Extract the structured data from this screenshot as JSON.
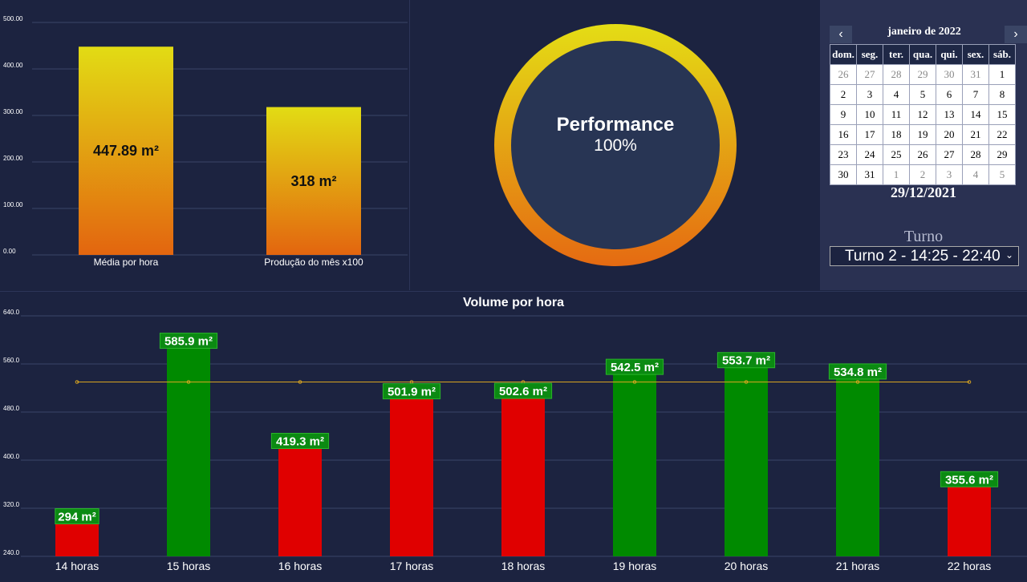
{
  "top_chart": {
    "chart_data": {
      "type": "bar",
      "categories": [
        "Média por hora",
        "Produção do mês x100"
      ],
      "values": [
        447.89,
        318
      ],
      "data_labels": [
        "447.89 m²",
        "318 m²"
      ],
      "ylim": [
        0,
        500
      ],
      "yticks": [
        "0.00",
        "100.00",
        "200.00",
        "300.00",
        "400.00",
        "500.00"
      ],
      "grid": true
    }
  },
  "performance": {
    "title": "Performance",
    "value": "100%",
    "fraction": 1.0
  },
  "calendar": {
    "prev_icon": "‹",
    "next_icon": "›",
    "month_title": "janeiro de 2022",
    "weekdays": [
      "dom.",
      "seg.",
      "ter.",
      "qua.",
      "qui.",
      "sex.",
      "sáb."
    ],
    "weeks": [
      [
        "26",
        "27",
        "28",
        "29",
        "30",
        "31",
        "1"
      ],
      [
        "2",
        "3",
        "4",
        "5",
        "6",
        "7",
        "8"
      ],
      [
        "9",
        "10",
        "11",
        "12",
        "13",
        "14",
        "15"
      ],
      [
        "16",
        "17",
        "18",
        "19",
        "20",
        "21",
        "22"
      ],
      [
        "23",
        "24",
        "25",
        "26",
        "27",
        "28",
        "29"
      ],
      [
        "30",
        "31",
        "1",
        "2",
        "3",
        "4",
        "5"
      ]
    ],
    "selected_date": "29/12/2021"
  },
  "turno": {
    "label": "Turno",
    "selected": "Turno 2 - 14:25 - 22:40"
  },
  "bottom_chart": {
    "chart_data": {
      "type": "bar",
      "title": "Volume por hora",
      "categories": [
        "14 horas",
        "15 horas",
        "16 horas",
        "17 horas",
        "18 horas",
        "19 horas",
        "20 horas",
        "21 horas",
        "22 horas"
      ],
      "values": [
        294,
        585.9,
        419.3,
        501.9,
        502.6,
        542.5,
        553.7,
        534.8,
        355.6
      ],
      "data_labels": [
        "294 m²",
        "585.9 m²",
        "419.3 m²",
        "501.9 m²",
        "502.6 m²",
        "542.5 m²",
        "553.7 m²",
        "534.8 m²",
        "355.6 m²"
      ],
      "target": 530,
      "ylim": [
        240,
        640
      ],
      "yticks": [
        "240.0",
        "320.0",
        "400.0",
        "480.0",
        "560.0",
        "640.0"
      ],
      "grid": true
    },
    "colors": {
      "above": "#008a00",
      "below": "#e00000",
      "target_line": "#d9a520"
    }
  }
}
